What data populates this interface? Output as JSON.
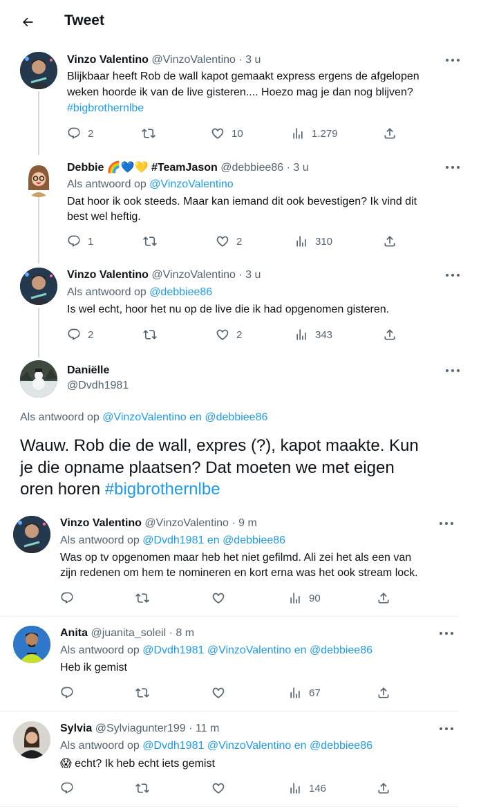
{
  "header": {
    "title": "Tweet"
  },
  "tweets": [
    {
      "name": "Vinzo Valentino",
      "handle": "@VinzoValentino",
      "time": "3 u",
      "lines": [
        "Blijkbaar heeft Rob de wall kapot gemaakt express ergens de afgelopen",
        "weken hoorde ik van de live gisteren.... Hoezo mag je dan nog blijven?"
      ],
      "hashtag": "#bigbrothernlbe",
      "replies": "2",
      "retweets": "",
      "likes": "10",
      "views": "1.279"
    },
    {
      "name": "Debbie",
      "name_suffix": "#TeamJason",
      "emojis": "🌈💙💛",
      "handle": "@debbiee86",
      "time": "3 u",
      "reply_label": "Als antwoord op",
      "reply_to": "@VinzoValentino",
      "lines": [
        "Dat hoor ik ook steeds. Maar kan iemand dit ook bevestigen? Ik vind dit",
        "best wel heftig."
      ],
      "replies": "1",
      "retweets": "",
      "likes": "2",
      "views": "310"
    },
    {
      "name": "Vinzo Valentino",
      "handle": "@VinzoValentino",
      "time": "3 u",
      "reply_label": "Als antwoord op",
      "reply_to": "@debbiee86",
      "lines": [
        "Is wel echt, hoor het nu op de live die ik had opgenomen gisteren."
      ],
      "replies": "2",
      "retweets": "",
      "likes": "2",
      "views": "343"
    }
  ],
  "main_tweet": {
    "name": "Daniëlle",
    "handle": "@Dvdh1981",
    "reply_label": "Als antwoord op",
    "reply_to": "@VinzoValentino en @debbiee86",
    "lines": [
      "Wauw. Rob die de wall, expres (?), kapot maakte. Kun",
      "je die opname plaatsen? Dat moeten we met eigen"
    ],
    "last_line": "oren horen",
    "hashtag": "#bigbrothernlbe"
  },
  "replies": [
    {
      "name": "Vinzo Valentino",
      "handle": "@VinzoValentino",
      "time": "9 m",
      "reply_label": "Als antwoord op",
      "reply_to": "@Dvdh1981 en @debbiee86",
      "lines": [
        "Was op tv opgenomen maar heb het niet gefilmd. Ali zei het als een van",
        "zijn redenen om hem te nomineren en kort erna was het ook stream lock."
      ],
      "views": "90"
    },
    {
      "name": "Anita",
      "handle": "@juanita_soleil",
      "time": "8 m",
      "reply_label": "Als antwoord op",
      "reply_to": "@Dvdh1981 @VinzoValentino en @debbiee86",
      "lines": [
        "Heb ik gemist"
      ],
      "views": "67"
    },
    {
      "name": "Sylvia",
      "handle": "@Sylviagunter199",
      "time": "11 m",
      "reply_label": "Als antwoord op",
      "reply_to": "@Dvdh1981 @VinzoValentino en @debbiee86",
      "emoji": "😱",
      "lines": [
        "echt? Ik heb echt iets gemist"
      ],
      "views": "146"
    }
  ],
  "colors": {
    "link": "#1d9bf0",
    "muted": "#536471",
    "text": "#0f1419"
  }
}
